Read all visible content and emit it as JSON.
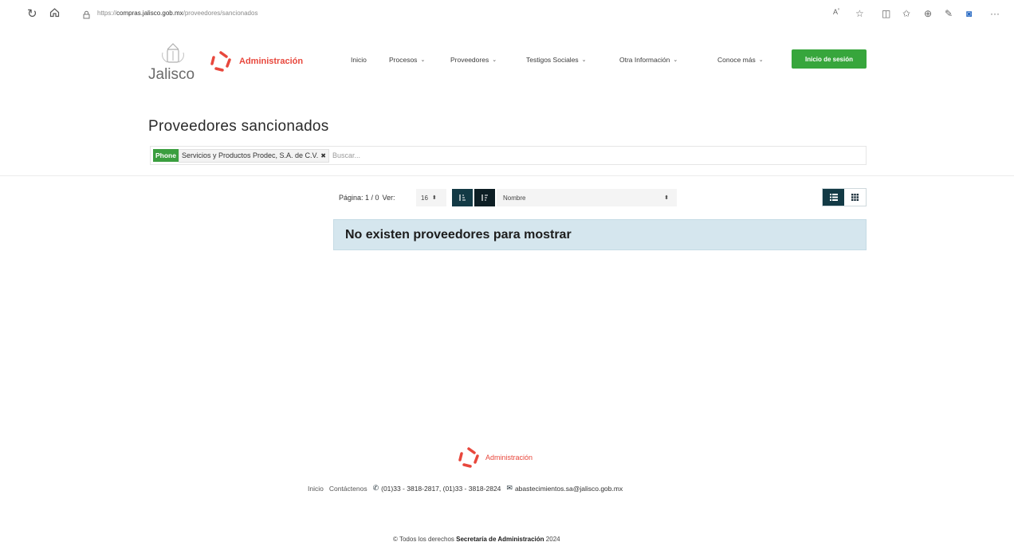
{
  "browser": {
    "url_prefix": "https://",
    "url_host": "compras.jalisco.gob.mx",
    "url_path": "/proveedores/sancionados",
    "icons": [
      "reload-icon",
      "home-icon",
      "lock-icon",
      "read-aloud-icon",
      "favorite-icon",
      "split-screen-icon",
      "favorites-list-icon",
      "collections-icon",
      "extensions-icon",
      "outlook-icon",
      "more-icon"
    ]
  },
  "header": {
    "jalisco_logo_text": "Jalisco",
    "admin_logo_text": "Administración",
    "nav": [
      {
        "label": "Inicio",
        "dropdown": false
      },
      {
        "label": "Procesos",
        "dropdown": true
      },
      {
        "label": "Proveedores",
        "dropdown": true
      },
      {
        "label": "Testigos Sociales",
        "dropdown": true
      },
      {
        "label": "Otra Información",
        "dropdown": true
      },
      {
        "label": "Conoce más",
        "dropdown": true
      }
    ],
    "login_label": "Inicio de sesión"
  },
  "main": {
    "title": "Proveedores sancionados",
    "filter": {
      "tag_label": "Phone",
      "tag_value": "Servicios y Productos Prodec, S.A. de C.V.",
      "remove_glyph": "✖",
      "search_placeholder": "Buscar..."
    },
    "toolbar": {
      "pagina_label": "Página: 1 / 0",
      "ver_label": "Ver:",
      "per_page": "16",
      "order_by": "Nombre"
    },
    "empty_message": "No existen proveedores para mostrar"
  },
  "footer": {
    "admin_logo_text": "Administración",
    "links": [
      "Inicio",
      "Contáctenos"
    ],
    "phone": "(01)33 - 3818-2817, (01)33 - 3818-2824",
    "email": "abastecimientos.sa@jalisco.gob.mx",
    "copyright_prefix": "© Todos los derechos",
    "copyright_org": "Secretaría de Administración",
    "copyright_year": "2024"
  },
  "colors": {
    "accent_red": "#e8473c",
    "login_green": "#37a63c",
    "dark_teal": "#133a45",
    "alert_blue": "#d5e6ee"
  }
}
